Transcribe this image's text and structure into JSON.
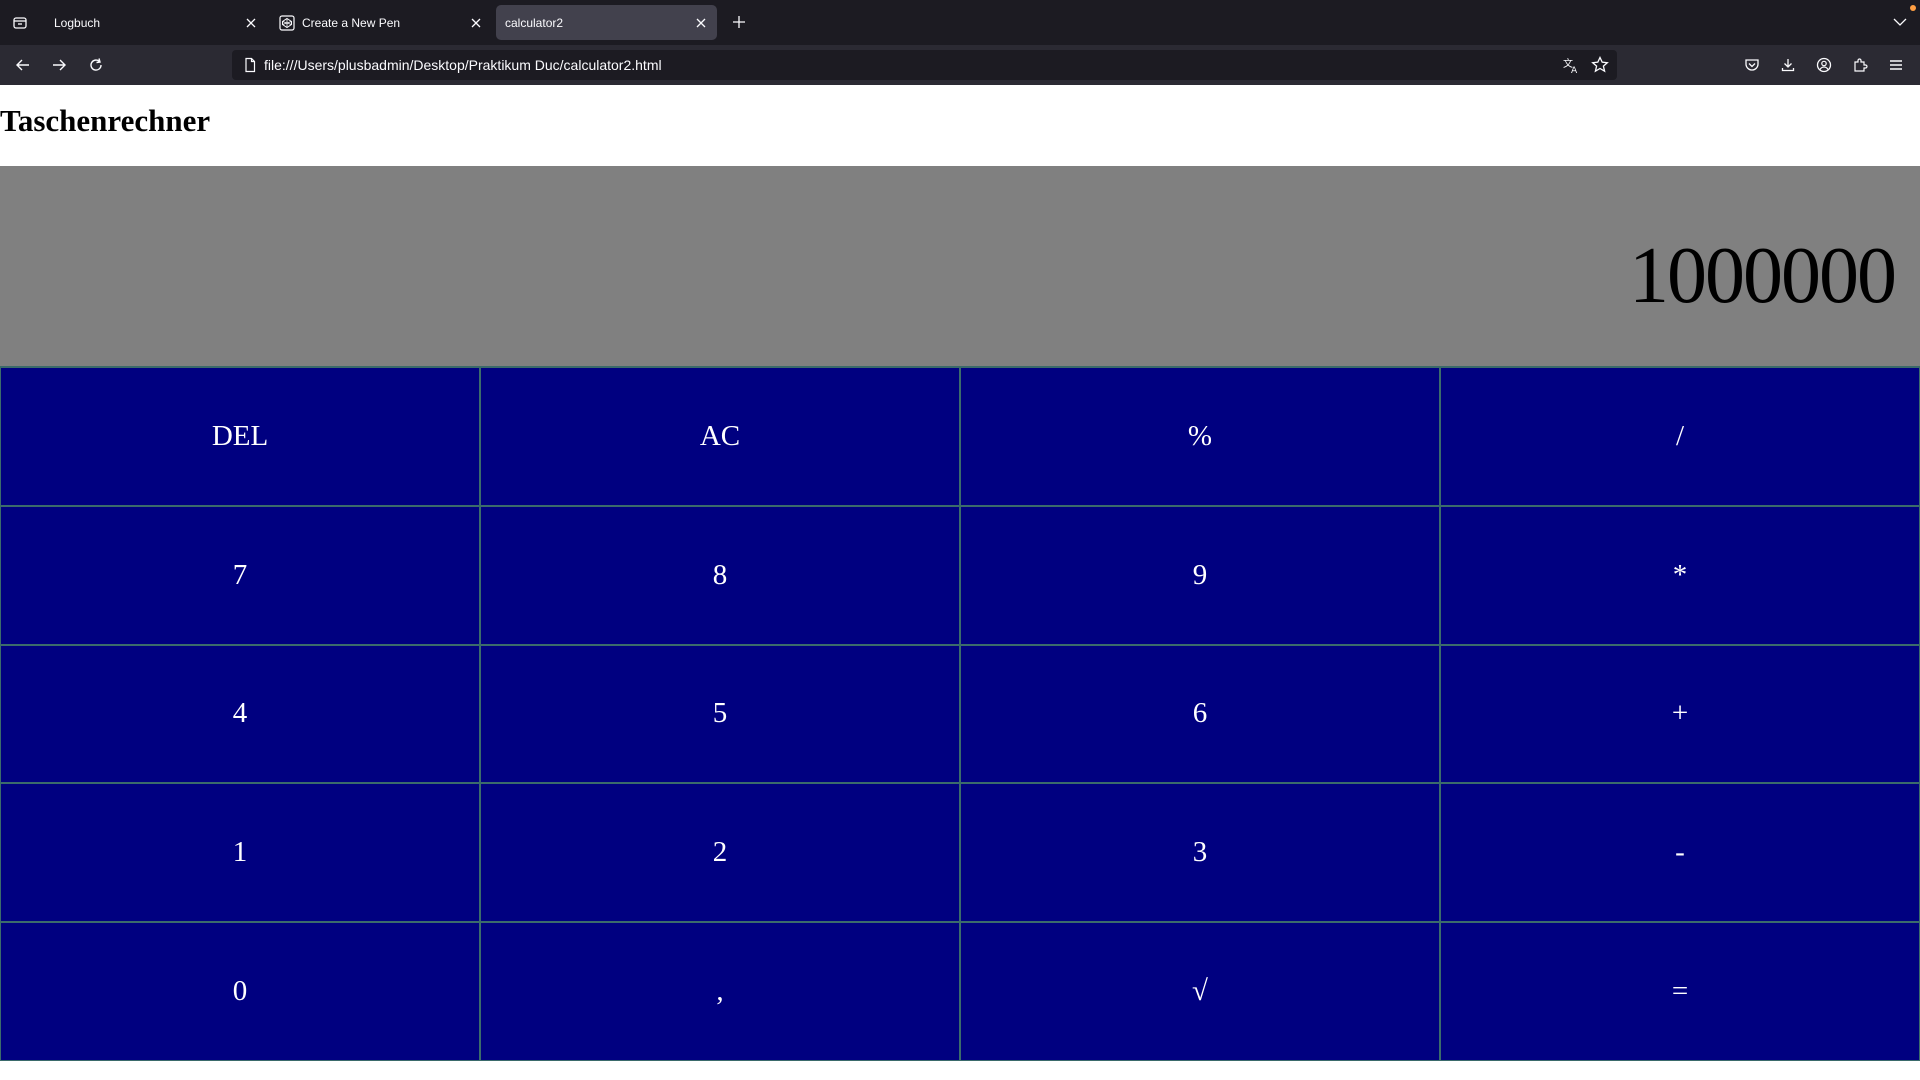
{
  "browser": {
    "tabs": [
      {
        "label": "Logbuch",
        "active": false,
        "has_favicon": false
      },
      {
        "label": "Create a New Pen",
        "active": false,
        "has_favicon": true,
        "favicon": "codepen-icon"
      },
      {
        "label": "calculator2",
        "active": true,
        "has_favicon": false
      }
    ],
    "url": "file:///Users/plusbadmin/Desktop/Praktikum Duc/calculator2.html",
    "colors": {
      "tabbar": "#1c1b22",
      "navbar": "#2b2a33",
      "active_tab": "#42414d",
      "text": "#fbfbfe"
    }
  },
  "page": {
    "title": "Taschenrechner",
    "display_value": "1000000",
    "colors": {
      "display_bg": "#808080",
      "key_bg": "#000080",
      "key_text": "#ffffff",
      "key_border": "#3b6b6b"
    },
    "keys": [
      [
        "DEL",
        "AC",
        "%",
        "/"
      ],
      [
        "7",
        "8",
        "9",
        "*"
      ],
      [
        "4",
        "5",
        "6",
        "+"
      ],
      [
        "1",
        "2",
        "3",
        "-"
      ],
      [
        "0",
        ",",
        "√",
        "="
      ]
    ]
  }
}
